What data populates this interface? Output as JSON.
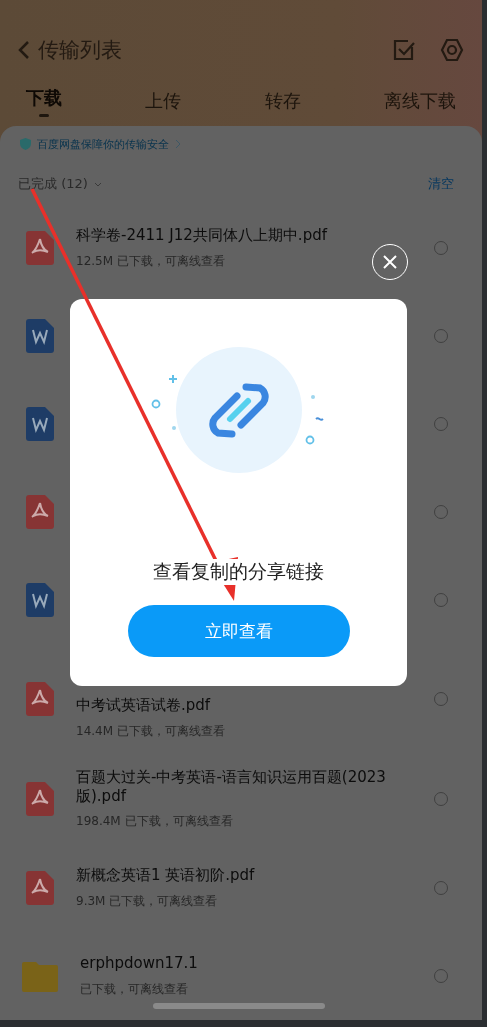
{
  "header": {
    "title": "传输列表"
  },
  "tabs": [
    {
      "label": "下载",
      "selected": true
    },
    {
      "label": "上传",
      "selected": false
    },
    {
      "label": "转存",
      "selected": false
    },
    {
      "label": "离线下载",
      "selected": false
    }
  ],
  "banner": "百度网盘保障你的传输安全",
  "section": {
    "title": "已完成 (12)",
    "action": "清空"
  },
  "files": [
    {
      "kind": "pdf",
      "name": "科学卷-2411 J12共同体八上期中.pdf",
      "info": "12.5M  已下载，可离线查看",
      "selected": false
    },
    {
      "kind": "word",
      "selected": false
    },
    {
      "kind": "word",
      "selected": false
    },
    {
      "kind": "pdf",
      "selected": false
    },
    {
      "kind": "word",
      "selected": false
    },
    {
      "kind": "pdf",
      "name": "中考试英语试卷.pdf",
      "info": "14.4M  已下载，可离线查看",
      "clipped": true,
      "selected": false
    },
    {
      "kind": "pdf",
      "name": "百题大过关-中考英语-语言知识运用百题(2023版).pdf",
      "info": "198.4M  已下载，可离线查看",
      "selected": false
    },
    {
      "kind": "pdf",
      "name": "新概念英语1 英语初阶.pdf",
      "info": "9.3M  已下载，可离线查看",
      "selected": false
    },
    {
      "kind": "folder",
      "name": "erphpdown17.1",
      "info": "已下载，可离线查看",
      "selected": false
    }
  ],
  "dialog": {
    "message": "查看复制的分享链接",
    "button": "立即查看"
  }
}
